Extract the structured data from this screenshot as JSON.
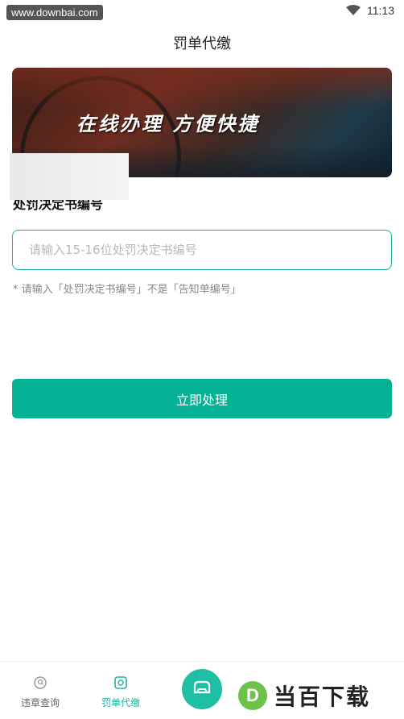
{
  "status_bar": {
    "watermark": "www.downbai.com",
    "time": "11:13",
    "wifi_icon": "wifi-icon"
  },
  "header": {
    "title": "罚单代缴"
  },
  "banner": {
    "text": "在线办理  方便快捷"
  },
  "form": {
    "label": "处罚决定书编号",
    "placeholder": "请输入15-16位处罚决定书编号",
    "value": "",
    "hint": "* 请输入「处罚决定书编号」不是「告知单编号」",
    "submit_label": "立即处理"
  },
  "tab_bar": {
    "tabs": [
      {
        "label": "违章查询",
        "icon": "search-icon",
        "active": false
      },
      {
        "label": "罚单代缴",
        "icon": "ticket-icon",
        "active": true
      }
    ],
    "center_icon": "car-icon"
  },
  "brand_watermark": {
    "logo": "D",
    "text": "当百下载"
  },
  "colors": {
    "accent": "#06b296",
    "input_border": "#1fb39a",
    "center_button": "#1fbfa6"
  }
}
